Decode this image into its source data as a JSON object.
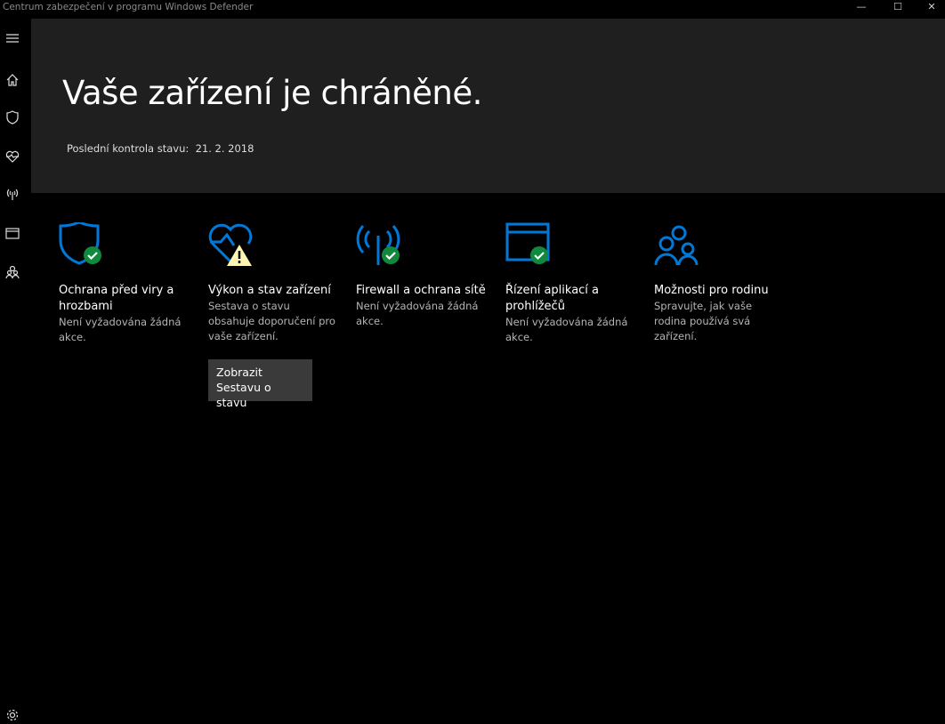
{
  "window": {
    "title": "Centrum zabezpečení v programu Windows Defender",
    "minimize": "—",
    "maximize": "☐",
    "close": "✕"
  },
  "header": {
    "title": "Vaše zařízení je chráněné.",
    "status_label": "Poslední kontrola stavu:",
    "status_date": "21. 2. 2018"
  },
  "tiles": [
    {
      "title": "Ochrana před viry a hrozbami",
      "desc": "Není vyžadována žádná akce."
    },
    {
      "title": "Výkon a stav zařízení",
      "desc": "Sestava o stavu obsahuje doporučení pro vaše zařízení.",
      "button": "Zobrazit Sestavu o stavu"
    },
    {
      "title": "Firewall a ochrana sítě",
      "desc": "Není vyžadována žádná akce."
    },
    {
      "title": "Řízení aplikací a prohlížečů",
      "desc": "Není vyžadována žádná akce."
    },
    {
      "title": "Možnosti pro rodinu",
      "desc": "Spravujte, jak vaše rodina používá svá zařízení."
    }
  ],
  "colors": {
    "accent": "#0078d7",
    "ok": "#10893e",
    "warn": "#fff4b0",
    "hero": "#1f1f1f"
  }
}
